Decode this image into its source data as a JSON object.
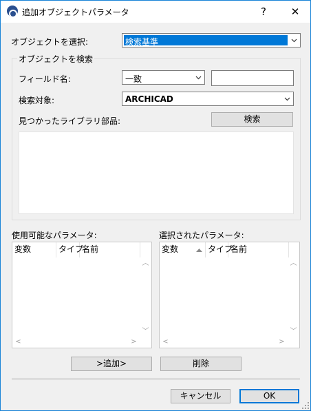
{
  "window": {
    "title": "追加オブジェクトパラメータ",
    "help_glyph": "?",
    "close_glyph": "✕"
  },
  "select_object": {
    "label": "オブジェクトを選択:",
    "value": "検索基準"
  },
  "search_group": {
    "title": "オブジェクトを検索",
    "field_name_label": "フィールド名:",
    "field_match_value": "一致",
    "field_text_value": "",
    "search_target_label": "検索対象:",
    "search_target_value": "ARCHICAD",
    "found_parts_label": "見つかったライブラリ部品:",
    "search_button": "検索"
  },
  "available_params": {
    "label": "使用可能なパラメータ:",
    "columns": [
      "変数",
      "タイプ",
      "名前"
    ]
  },
  "selected_params": {
    "label": "選択されたパラメータ:",
    "columns": [
      "変数",
      "タイプ",
      "名前"
    ]
  },
  "actions": {
    "add_button": ">追加>",
    "delete_button": "削除"
  },
  "footer": {
    "cancel_button": "キャンセル",
    "ok_button": "OK"
  },
  "colors": {
    "accent": "#0078d7",
    "window_border": "#1883d7",
    "background": "#f0f0f0"
  },
  "icons": {
    "app": "archicad-logo-icon",
    "dropdown": "chevron-down-icon",
    "scroll_up": "scroll-up-arrow-icon",
    "scroll_down": "scroll-down-arrow-icon",
    "scroll_left": "scroll-left-arrow-icon",
    "scroll_right": "scroll-right-arrow-icon",
    "sort_ascending": "sort-ascending-icon"
  }
}
